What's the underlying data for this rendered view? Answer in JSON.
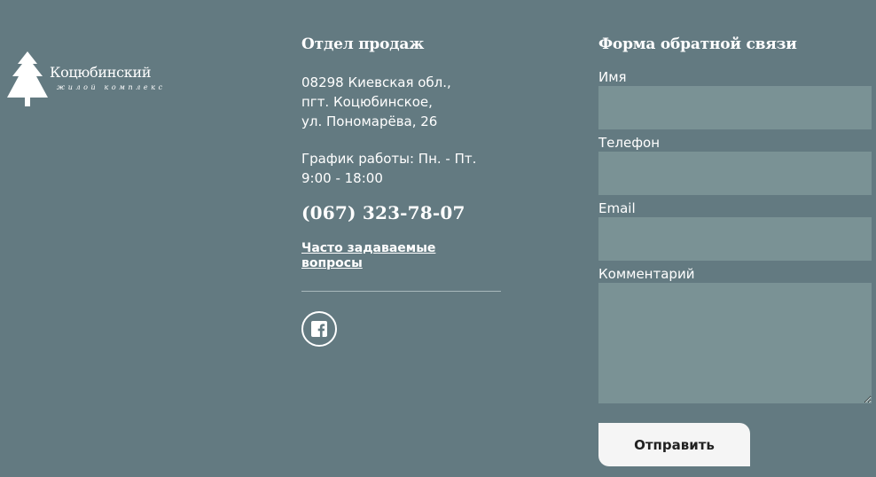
{
  "logo": {
    "name": "Коцюбинский",
    "subtitle": "жилой комплекс"
  },
  "sales": {
    "heading": "Отдел продаж",
    "address": [
      "08298 Киевская обл.,",
      "пгт. Коцюбинское,",
      "ул. Пономарёва, 26"
    ],
    "hours": [
      "График работы: Пн. - Пт.",
      "9:00 - 18:00"
    ],
    "phone": "(067) 323-78-07",
    "faq": [
      "Часто задаваемые",
      "вопросы"
    ],
    "social_icon": "facebook-icon"
  },
  "form": {
    "heading": "Форма обратной связи",
    "name_label": "Имя",
    "phone_label": "Телефон",
    "email_label": "Email",
    "comment_label": "Комментарий",
    "name_value": "",
    "phone_value": "",
    "email_value": "",
    "comment_value": "",
    "submit_label": "Отправить"
  },
  "colors": {
    "background": "#637a81",
    "input": "#7a9295",
    "button": "#f5f5f5"
  }
}
